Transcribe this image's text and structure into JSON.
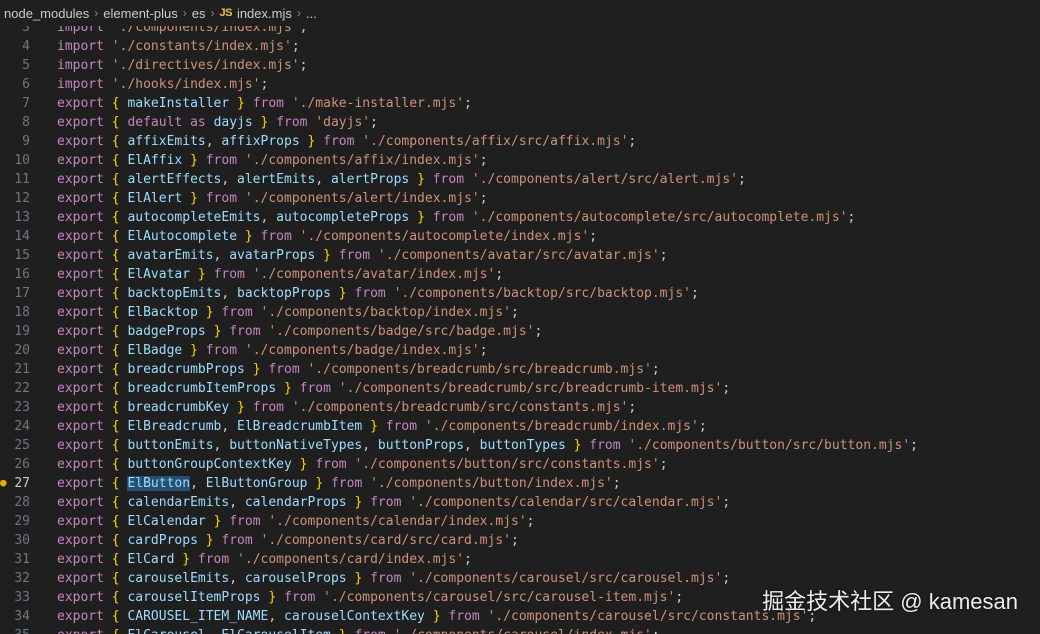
{
  "breadcrumb": {
    "parts": [
      "node_modules",
      "element-plus",
      "es"
    ],
    "file_icon": "JS",
    "file": "index.mjs",
    "trailing": "..."
  },
  "editor": {
    "active_line": 27,
    "highlighted_word": "ElButton",
    "lines": [
      {
        "n": "3",
        "t": "import './components/index.mjs';"
      },
      {
        "n": "4",
        "t": "import './constants/index.mjs';"
      },
      {
        "n": "5",
        "t": "import './directives/index.mjs';"
      },
      {
        "n": "6",
        "t": "import './hooks/index.mjs';"
      },
      {
        "n": "7",
        "t": "export { makeInstaller } from './make-installer.mjs';"
      },
      {
        "n": "8",
        "t": "export { default as dayjs } from 'dayjs';"
      },
      {
        "n": "9",
        "t": "export { affixEmits, affixProps } from './components/affix/src/affix.mjs';"
      },
      {
        "n": "10",
        "t": "export { ElAffix } from './components/affix/index.mjs';"
      },
      {
        "n": "11",
        "t": "export { alertEffects, alertEmits, alertProps } from './components/alert/src/alert.mjs';"
      },
      {
        "n": "12",
        "t": "export { ElAlert } from './components/alert/index.mjs';"
      },
      {
        "n": "13",
        "t": "export { autocompleteEmits, autocompleteProps } from './components/autocomplete/src/autocomplete.mjs';"
      },
      {
        "n": "14",
        "t": "export { ElAutocomplete } from './components/autocomplete/index.mjs';"
      },
      {
        "n": "15",
        "t": "export { avatarEmits, avatarProps } from './components/avatar/src/avatar.mjs';"
      },
      {
        "n": "16",
        "t": "export { ElAvatar } from './components/avatar/index.mjs';"
      },
      {
        "n": "17",
        "t": "export { backtopEmits, backtopProps } from './components/backtop/src/backtop.mjs';"
      },
      {
        "n": "18",
        "t": "export { ElBacktop } from './components/backtop/index.mjs';"
      },
      {
        "n": "19",
        "t": "export { badgeProps } from './components/badge/src/badge.mjs';"
      },
      {
        "n": "20",
        "t": "export { ElBadge } from './components/badge/index.mjs';"
      },
      {
        "n": "21",
        "t": "export { breadcrumbProps } from './components/breadcrumb/src/breadcrumb.mjs';"
      },
      {
        "n": "22",
        "t": "export { breadcrumbItemProps } from './components/breadcrumb/src/breadcrumb-item.mjs';"
      },
      {
        "n": "23",
        "t": "export { breadcrumbKey } from './components/breadcrumb/src/constants.mjs';"
      },
      {
        "n": "24",
        "t": "export { ElBreadcrumb, ElBreadcrumbItem } from './components/breadcrumb/index.mjs';"
      },
      {
        "n": "25",
        "t": "export { buttonEmits, buttonNativeTypes, buttonProps, buttonTypes } from './components/button/src/button.mjs';"
      },
      {
        "n": "26",
        "t": "export { buttonGroupContextKey } from './components/button/src/constants.mjs';"
      },
      {
        "n": "27",
        "t": "export { ElButton, ElButtonGroup } from './components/button/index.mjs';"
      },
      {
        "n": "28",
        "t": "export { calendarEmits, calendarProps } from './components/calendar/src/calendar.mjs';"
      },
      {
        "n": "29",
        "t": "export { ElCalendar } from './components/calendar/index.mjs';"
      },
      {
        "n": "30",
        "t": "export { cardProps } from './components/card/src/card.mjs';"
      },
      {
        "n": "31",
        "t": "export { ElCard } from './components/card/index.mjs';"
      },
      {
        "n": "32",
        "t": "export { carouselEmits, carouselProps } from './components/carousel/src/carousel.mjs';"
      },
      {
        "n": "33",
        "t": "export { carouselItemProps } from './components/carousel/src/carousel-item.mjs';"
      },
      {
        "n": "34",
        "t": "export { CAROUSEL_ITEM_NAME, carouselContextKey } from './components/carousel/src/constants.mjs';"
      },
      {
        "n": "35",
        "t": "export { ElCarousel, ElCarouselItem } from './components/carousel/index.mjs';"
      }
    ]
  },
  "watermark": "掘金技术社区 @ kamesan",
  "colors": {
    "background": "#1f1f1f",
    "keyword": "#c586c0",
    "bracket": "#ffd700",
    "identifier": "#9cdcfe",
    "string": "#ce9178",
    "line_number": "#6e7681",
    "selection": "#264f78"
  }
}
